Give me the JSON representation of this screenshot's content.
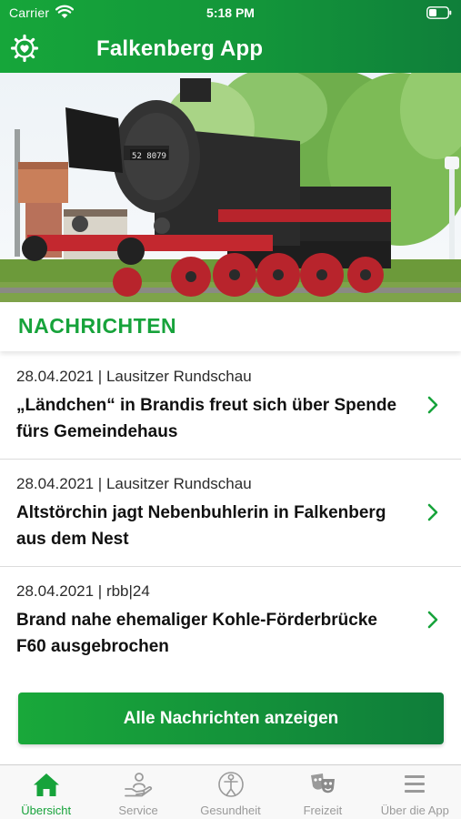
{
  "status_bar": {
    "carrier": "Carrier",
    "time": "5:18 PM"
  },
  "header": {
    "title": "Falkenberg App",
    "settings_icon": "gear-heart-icon"
  },
  "hero": {
    "locomotive_number": "52 8079"
  },
  "news": {
    "section_title": "NACHRICHTEN",
    "items": [
      {
        "meta": "28.04.2021 | Lausitzer Rundschau",
        "title": "„Ländchen“ in Brandis freut sich über Spende fürs Gemeindehaus"
      },
      {
        "meta": "28.04.2021 | Lausitzer Rundschau",
        "title": "Altstörchin jagt Nebenbuhlerin in Falkenberg aus dem Nest"
      },
      {
        "meta": "28.04.2021 | rbb|24",
        "title": "Brand nahe ehemaliger Kohle-Förderbrücke F60 ausgebrochen"
      }
    ],
    "all_button_label": "Alle Nachrichten anzeigen"
  },
  "tabbar": {
    "tabs": [
      {
        "label": "Übersicht",
        "icon": "home-icon",
        "active": true
      },
      {
        "label": "Service",
        "icon": "service-hand-icon",
        "active": false
      },
      {
        "label": "Gesundheit",
        "icon": "health-person-icon",
        "active": false
      },
      {
        "label": "Freizeit",
        "icon": "theater-masks-icon",
        "active": false
      },
      {
        "label": "Über die App",
        "icon": "menu-icon",
        "active": false
      }
    ]
  },
  "colors": {
    "brand_green": "#17a33b",
    "brand_green_dark": "#0f7d3a",
    "inactive_gray": "#9a9a9a"
  }
}
